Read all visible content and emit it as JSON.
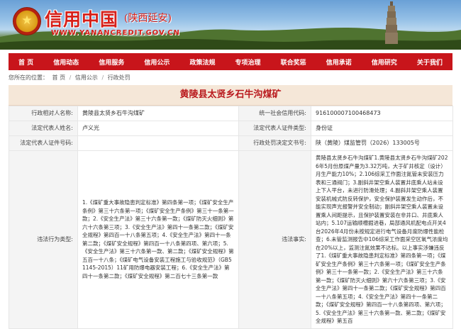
{
  "header": {
    "title": "信用中国",
    "subtitle": "(陕西延安)",
    "url": "WWW.YANANCREDIT.GOV.CN"
  },
  "nav": {
    "items": [
      {
        "label": "首 页"
      },
      {
        "label": "信用动态"
      },
      {
        "label": "信用服务"
      },
      {
        "label": "信用公示"
      },
      {
        "label": "政策法规"
      },
      {
        "label": "专项治理"
      },
      {
        "label": "联合奖惩"
      },
      {
        "label": "信用承诺"
      },
      {
        "label": "信用研究"
      },
      {
        "label": "关于我们"
      }
    ]
  },
  "breadcrumb": {
    "prefix": "您所在的位置：",
    "home": "首 页",
    "level1": "信用公示",
    "level2": "行政处罚",
    "separator": "/"
  },
  "record": {
    "title": "黄陵县太贤乡石牛沟煤矿",
    "rows": {
      "r1": {
        "l1": "行政相对人名称:",
        "v1": "黄陵县太贤乡石牛沟煤矿",
        "l2": "统一社会信用代码:",
        "v2": "91610000710046847З"
      },
      "r2": {
        "l1": "法定代表人姓名:",
        "v1": "卢义光",
        "l2": "法定代表人证件类型:",
        "v2": "身份证"
      },
      "r3": {
        "l1": "法定代表人证件号码:",
        "v1": "",
        "l2": "行政处罚决定文书号:",
        "v2": "陕（黄陵）煤监管罚（2026）133005号"
      },
      "r4": {
        "l1": "违法行为类型:",
        "v1": "1.《煤矿重大事故隐患判定标准》第四条第一项；《煤矿安全生产条例》第三十六条第一项；《煤矿安全生产条例》第三十一条第一款；2.《安全生产法》第三十六条第一款；《煤矿防灭火细则》第六十六条第三项；3.《安全生产法》第四十一条第二款；《煤矿安全规程》第四百一十八条第五项；4.《安全生产法》第四十一条第二款；《煤矿安全规程》第四百一十八条第四项、第六项；5.《安全生产法》第三十六条第一款、第二款；《煤矿安全规程》第五百一十八条；《煤矿电气设备安装工程施工与验收规范》（GB51145-2015）11矿用防爆电器安装工程；6.《安全生产法》第四十一条第二款；《煤矿安全规程》第二百七十三条第一款",
        "l2": "违法事实:",
        "v2": "黄陵县太贤乡石牛沟煤矿1.黄陵县太贤乡石牛沟煤矿2026年5月份原煤产量为3.32万吨，大于矿井核定（设计）月生产能力10%；2.106综采工作面注氮管未安装压力表和三通阀门；3.副斜井架空乘人装置井底乘人站未设上下人平台，未进行防滑处理；4.副斜井架空乘人装置安装机械式防反转保护，安全保护装置发生动作后，不能实现声光报警并安全制动；副斜井架空乘人装置未设置乘人间距提示，且保护装置安装在非井口、井底乘人站内；5.107运输顺槽掘进巷，局部通风机配电点开关4台2026年4月份未按规定进行电气设备月度防爆性能检查；6.未管监测报告中106综采工作面采空区氧气浓度均在20%以上，监测注氮效果不达标。以上事实涉嫌违反了1.《煤矿重大事故隐患判定标准》第四条第一项；《煤矿安全生产条例》第三十六条第一项；《煤矿安全生产条例》第三十一条第一款；2.《安全生产法》第三十六条第一款；《煤矿防灭火细则》第六十六条第三项；3.《安全生产法》第四十一条第二款；《煤矿安全规程》第四百一十八条第五项；4.《安全生产法》第四十一条第二款；《煤矿安全规程》第四百一十八条第四项、第六项；5.《安全生产法》第三十六条第一款、第二款；《煤矿安全规程》第五百"
      }
    }
  }
}
